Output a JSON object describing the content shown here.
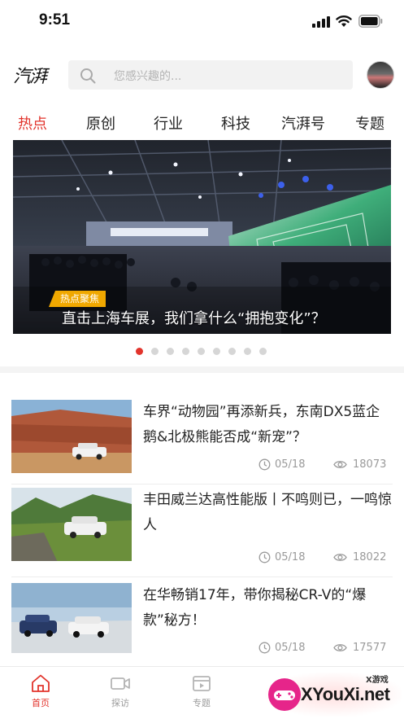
{
  "status_bar": {
    "time": "9:51"
  },
  "header": {
    "logo_text": "汽湃",
    "search_placeholder": "您感兴趣的..."
  },
  "tabs": [
    {
      "label": "热点",
      "active": true
    },
    {
      "label": "原创",
      "active": false
    },
    {
      "label": "行业",
      "active": false
    },
    {
      "label": "科技",
      "active": false
    },
    {
      "label": "汽湃号",
      "active": false
    },
    {
      "label": "专题",
      "active": false
    }
  ],
  "banner": {
    "badge": "热点聚焦",
    "title": "直击上海车展，我们拿什么“拥抱变化”？",
    "slide_count": 9,
    "active_slide": 1
  },
  "news": [
    {
      "title": "车界“动物园”再添新兵，东南DX5蓝企鹅&北极熊能否成“新宠”？",
      "date": "05/18",
      "views": "18073"
    },
    {
      "title": "丰田威兰达高性能版丨不鸣则已，一鸣惊人",
      "date": "05/18",
      "views": "18022"
    },
    {
      "title": "在华畅销17年，带你揭秘CR-V的“爆款”秘方！",
      "date": "05/18",
      "views": "17577"
    }
  ],
  "tabbar": [
    {
      "label": "首页",
      "icon": "home-icon",
      "active": true
    },
    {
      "label": "探访",
      "icon": "video-camera-icon",
      "active": false
    },
    {
      "label": "专题",
      "icon": "clapperboard-icon",
      "active": false
    }
  ],
  "watermark": {
    "small": "X游戏",
    "text": "XYouXi.net"
  },
  "colors": {
    "accent": "#e2342c",
    "badge": "#f0a800"
  }
}
